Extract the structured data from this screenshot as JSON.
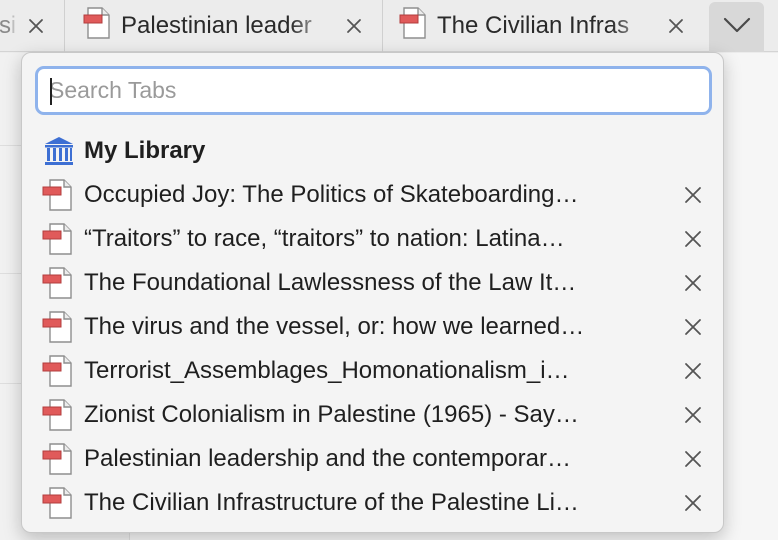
{
  "tab_bar": {
    "tabs": [
      {
        "title": "si",
        "close_icon": "close-icon"
      },
      {
        "title": "Palestinian leader",
        "close_icon": "close-icon"
      },
      {
        "title": "The Civilian Infras",
        "close_icon": "close-icon"
      }
    ],
    "menu_button_icon": "chevron-down-icon"
  },
  "popup": {
    "search": {
      "placeholder": "Search Tabs",
      "value": ""
    },
    "library": {
      "label": "My Library",
      "icon": "library-icon",
      "icon_color": "#3d6fd3"
    },
    "items": [
      {
        "label": "Occupied Joy: The Politics of Skateboarding…",
        "icon": "pdf-icon"
      },
      {
        "label": "“Traitors” to race, “traitors” to nation: Latina…",
        "icon": "pdf-icon"
      },
      {
        "label": "The Foundational Lawlessness of the Law It…",
        "icon": "pdf-icon"
      },
      {
        "label": "The virus and the vessel, or: how we learned…",
        "icon": "pdf-icon"
      },
      {
        "label": "Terrorist_Assemblages_Homonationalism_i…",
        "icon": "pdf-icon"
      },
      {
        "label": "Zionist Colonialism in Palestine (1965) - Say…",
        "icon": "pdf-icon"
      },
      {
        "label": "Palestinian leadership and the contemporar…",
        "icon": "pdf-icon"
      },
      {
        "label": "The Civilian Infrastructure of the Palestine Li…",
        "icon": "pdf-icon"
      }
    ]
  },
  "colors": {
    "pdf_badge": "#e05a5a",
    "focus_ring": "#8fb3ec",
    "library_icon": "#3d6fd3"
  }
}
